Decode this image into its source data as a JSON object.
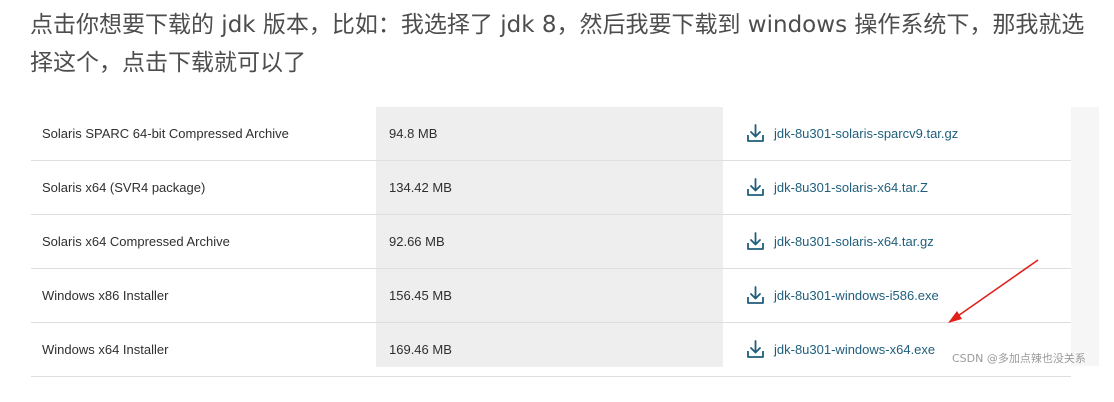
{
  "intro_text": "点击你想要下载的 jdk 版本，比如：我选择了 jdk 8，然后我要下载到 windows 操作系统下，那我就选择这个，点击下载就可以了",
  "downloads": [
    {
      "name": "Solaris SPARC 64-bit Compressed Archive",
      "size": "94.8 MB",
      "file": "jdk-8u301-solaris-sparcv9.tar.gz"
    },
    {
      "name": "Solaris x64 (SVR4 package)",
      "size": "134.42 MB",
      "file": "jdk-8u301-solaris-x64.tar.Z"
    },
    {
      "name": "Solaris x64 Compressed Archive",
      "size": "92.66 MB",
      "file": "jdk-8u301-solaris-x64.tar.gz"
    },
    {
      "name": "Windows x86 Installer",
      "size": "156.45 MB",
      "file": "jdk-8u301-windows-i586.exe"
    },
    {
      "name": "Windows x64 Installer",
      "size": "169.46 MB",
      "file": "jdk-8u301-windows-x64.exe"
    }
  ],
  "watermark": "CSDN @多加点辣也没关系",
  "colors": {
    "link": "#1f5e7c",
    "arrow": "#e0201b",
    "shade": "#eeeeee"
  },
  "icons": {
    "download": "download-icon"
  }
}
